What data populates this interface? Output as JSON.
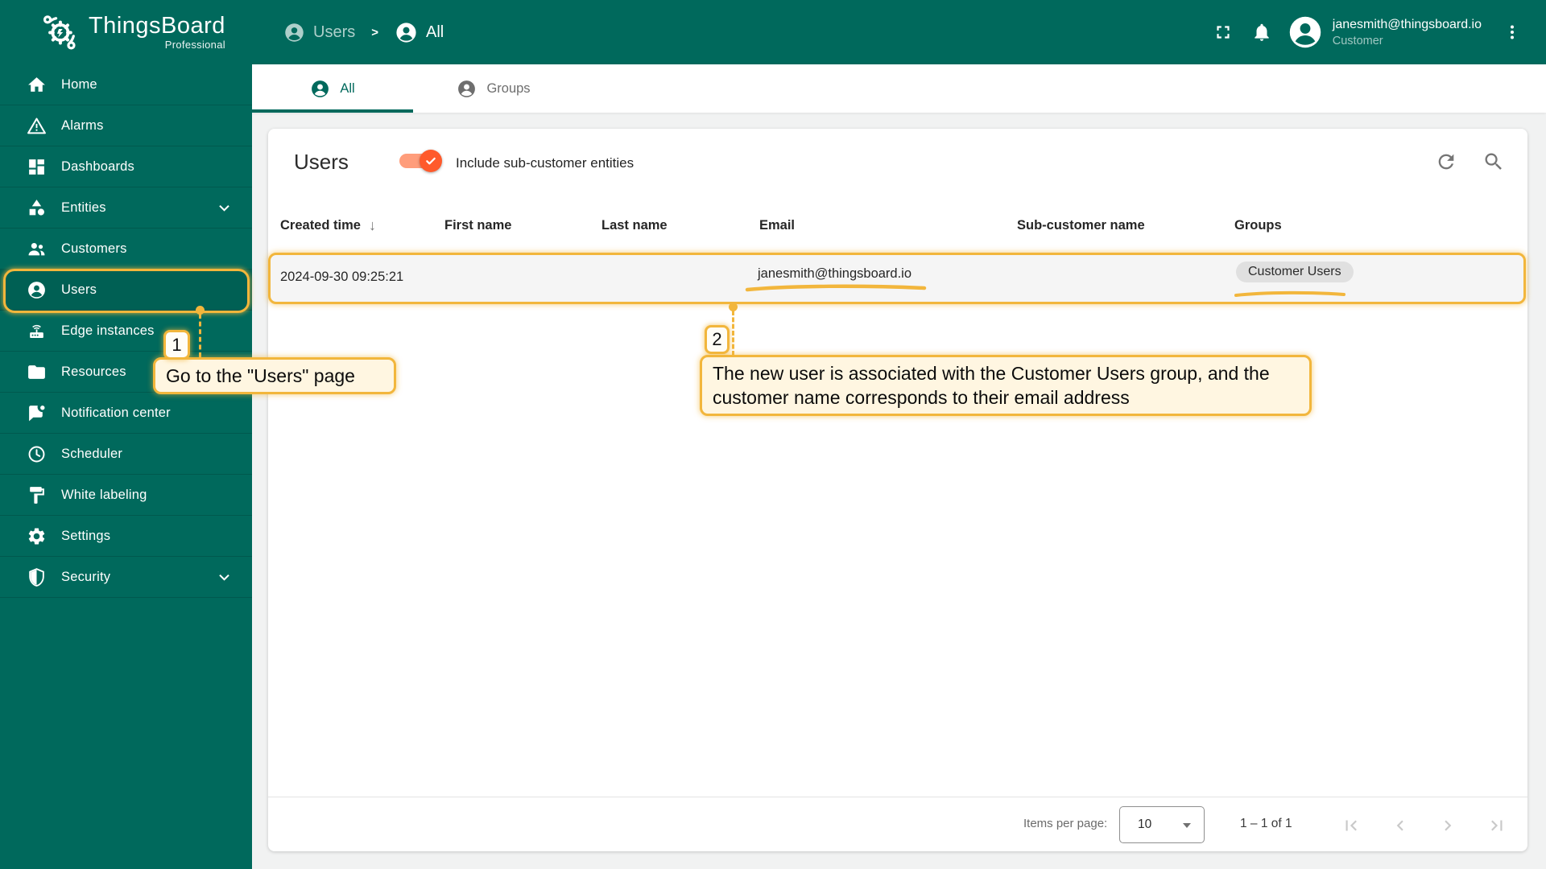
{
  "theme": {
    "primary": "#00695c",
    "accent": "#ff5a2b",
    "annotation": "#f2b63c"
  },
  "header": {
    "logo_title": "ThingsBoard",
    "logo_subtitle": "Professional",
    "breadcrumb": {
      "parent": "Users",
      "separator": ">",
      "current": "All"
    },
    "user_email": "janesmith@thingsboard.io",
    "user_role": "Customer"
  },
  "sidebar": {
    "items": [
      {
        "label": "Home"
      },
      {
        "label": "Alarms"
      },
      {
        "label": "Dashboards"
      },
      {
        "label": "Entities"
      },
      {
        "label": "Customers"
      },
      {
        "label": "Users"
      },
      {
        "label": "Edge instances"
      },
      {
        "label": "Resources"
      },
      {
        "label": "Notification center"
      },
      {
        "label": "Scheduler"
      },
      {
        "label": "White labeling"
      },
      {
        "label": "Settings"
      },
      {
        "label": "Security"
      }
    ]
  },
  "tabs": [
    {
      "label": "All",
      "active": true
    },
    {
      "label": "Groups",
      "active": false
    }
  ],
  "panel": {
    "title": "Users",
    "toggle_label": "Include sub-customer entities",
    "toggle_on": true
  },
  "table": {
    "columns": [
      "Created time",
      "First name",
      "Last name",
      "Email",
      "Sub-customer name",
      "Groups"
    ],
    "sort": {
      "column": "Created time",
      "direction": "desc",
      "arrow": "↓"
    },
    "rows": [
      {
        "created_time": "2024-09-30 09:25:21",
        "first_name": "",
        "last_name": "",
        "email": "janesmith@thingsboard.io",
        "sub_customer_name": "",
        "groups": [
          "Customer Users"
        ]
      }
    ]
  },
  "pagination": {
    "items_per_page_label": "Items per page:",
    "items_per_page": "10",
    "range": "1 – 1 of 1"
  },
  "annotations": [
    {
      "number": "1",
      "text": "Go to the \"Users\" page"
    },
    {
      "number": "2",
      "text": "The new user is associated with the Customer Users group, and the customer name corresponds to their email address"
    }
  ]
}
